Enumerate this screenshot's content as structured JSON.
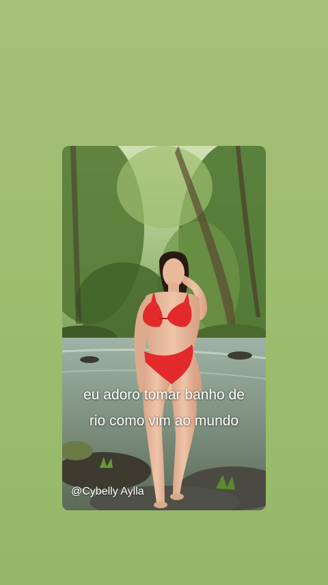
{
  "story": {
    "caption_line1": "eu adoro tomar banho de",
    "caption_line2": "rio como vim ao mundo",
    "handle": "@Cybelly Aylla"
  },
  "colors": {
    "background": "#9fbe6f",
    "swimsuit": "#e32a2a",
    "caption_text": "#ffffff"
  }
}
